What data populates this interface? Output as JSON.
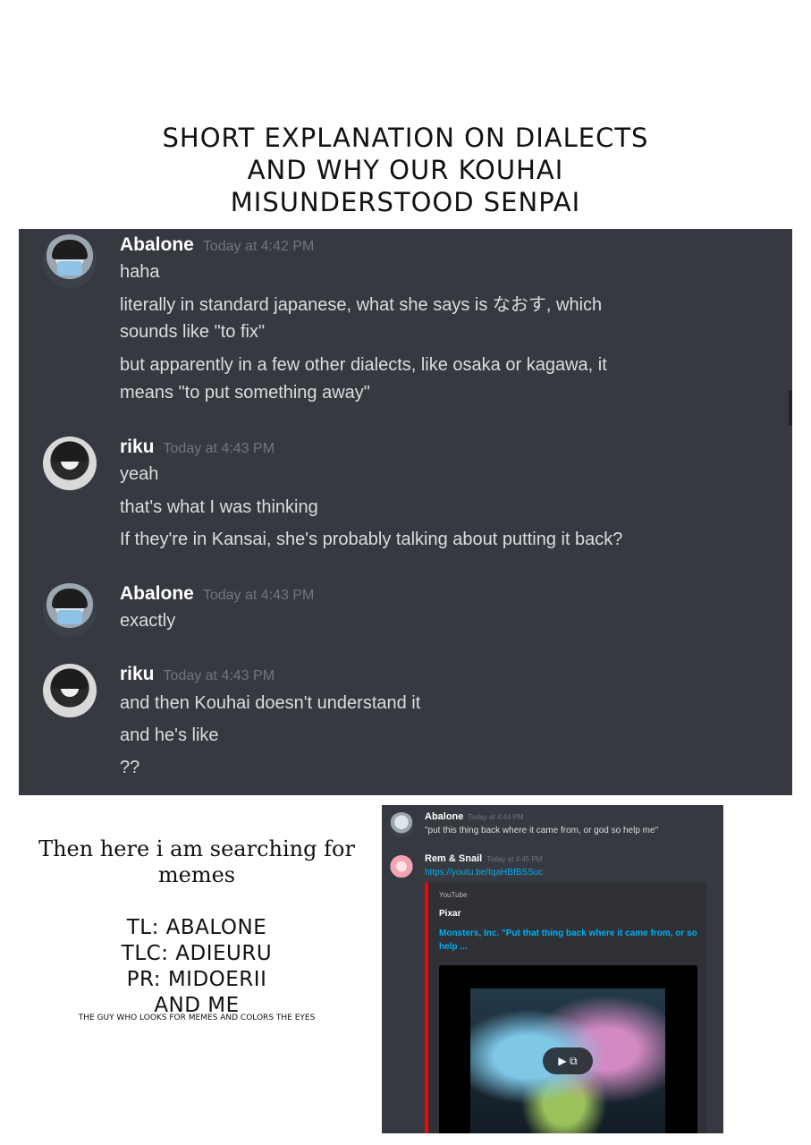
{
  "title": {
    "lines": [
      "Short explanation on dialects",
      "and why our Kouhai",
      "misunderstood Senpai"
    ]
  },
  "chat1": {
    "messages": [
      {
        "user": "Abalone",
        "time": "Today at 4:42 PM",
        "avatar": "abalone-avatar",
        "lines": [
          "haha",
          "literally in standard japanese, what she says is なおす, which",
          "sounds like \"to fix\"",
          "but apparently in a few other dialects, like osaka or kagawa, it",
          "means \"to put something away\""
        ]
      },
      {
        "user": "riku",
        "time": "Today at 4:43 PM",
        "avatar": "riku-avatar",
        "lines": [
          "yeah",
          "that's what I was thinking",
          "If they're in Kansai, she's probably talking about putting it back?"
        ]
      },
      {
        "user": "Abalone",
        "time": "Today at 4:43 PM",
        "avatar": "abalone-avatar",
        "lines": [
          "exactly"
        ]
      },
      {
        "user": "riku",
        "time": "Today at 4:43 PM",
        "avatar": "riku-avatar",
        "lines": [
          "and then Kouhai doesn't understand it",
          "and he's like",
          "??"
        ]
      }
    ]
  },
  "left_text": {
    "memes_line1": "Then here i am searching for",
    "memes_line2": "memes",
    "credits": [
      "TL: Abalone",
      "TLC: Adieuru",
      "PR: MidoErii",
      "and me"
    ],
    "note": "the guy who looks for memes and colors the eyes"
  },
  "chat2": {
    "msg1": {
      "user": "Abalone",
      "time": "Today at 4:44 PM",
      "text": "\"put this thing back where it came from, or god so help me\""
    },
    "msg2": {
      "user": "Rem & Snail",
      "time": "Today at 4:45 PM",
      "link": "https://youtu.be/tqaHBfBSSuc"
    },
    "embed": {
      "provider": "YouTube",
      "author": "Pixar",
      "title": "Monsters, Inc. \"Put that thing back where it came from, or so help ...",
      "play_icon": "play-icon"
    }
  },
  "colors": {
    "discord_bg": "#36393f",
    "username": "#ffffff",
    "timestamp": "#72767d",
    "message_text": "#dcddde",
    "link": "#00b0f4",
    "embed_border": "#ff0000"
  }
}
